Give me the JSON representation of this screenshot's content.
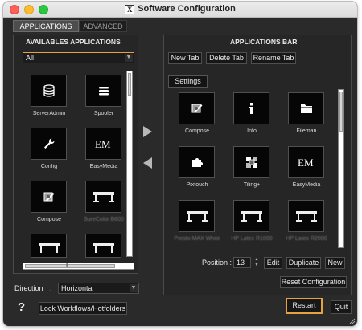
{
  "window": {
    "title": "Software Configuration",
    "logo_glyph": "X"
  },
  "tabs": [
    {
      "label": "APPLICATIONS",
      "active": true
    },
    {
      "label": "ADVANCED",
      "active": false
    }
  ],
  "available": {
    "title": "AVAILABLES APPLICATIONS",
    "filter_value": "All",
    "tiles": [
      {
        "label": "ServerAdmin",
        "icon": "database-icon"
      },
      {
        "label": "Spooler",
        "icon": "spooler-icon"
      },
      {
        "label": "Config",
        "icon": "wrench-icon"
      },
      {
        "label": "EasyMedia",
        "icon": "easymedia-icon"
      },
      {
        "label": "Compose",
        "icon": "compose-icon"
      },
      {
        "label": "SureColor B600",
        "icon": "printer-icon"
      },
      {
        "label": "",
        "icon": "printer-icon"
      },
      {
        "label": "",
        "icon": "printer-icon"
      }
    ],
    "scroll_grip": "III"
  },
  "bar": {
    "title": "APPLICATIONS BAR",
    "buttons": {
      "new_tab": "New Tab",
      "delete_tab": "Delete Tab",
      "rename_tab": "Rename Tab"
    },
    "current_tab": "Settings",
    "tiles": [
      {
        "label": "Compose",
        "icon": "compose-icon"
      },
      {
        "label": "Info",
        "icon": "info-icon"
      },
      {
        "label": "Fileman",
        "icon": "folder-icon"
      },
      {
        "label": "Pixtouch",
        "icon": "puzzle-icon"
      },
      {
        "label": "Tiling+",
        "icon": "tiling-icon"
      },
      {
        "label": "EasyMedia",
        "icon": "easymedia-icon"
      },
      {
        "label": "Presto MAX White",
        "icon": "printer-icon"
      },
      {
        "label": "HP Latex R1000",
        "icon": "printer-icon"
      },
      {
        "label": "HP Latex R2000",
        "icon": "printer-icon"
      }
    ],
    "position_label": "Position :",
    "position_value": "13",
    "edit_label": "Edit",
    "duplicate_label": "Duplicate",
    "new_label": "New",
    "reset_label": "Reset Configuration"
  },
  "direction": {
    "label": "Direction",
    "separator": ":",
    "value": "Horizontal"
  },
  "footer": {
    "help_glyph": "?",
    "lock_label": "Lock Workflows/Hotfolders",
    "restart_label": "Restart",
    "quit_label": "Quit"
  },
  "colors": {
    "accent": "#e6a23c",
    "background": "#2a2a2a",
    "tile_bg": "#060606"
  }
}
